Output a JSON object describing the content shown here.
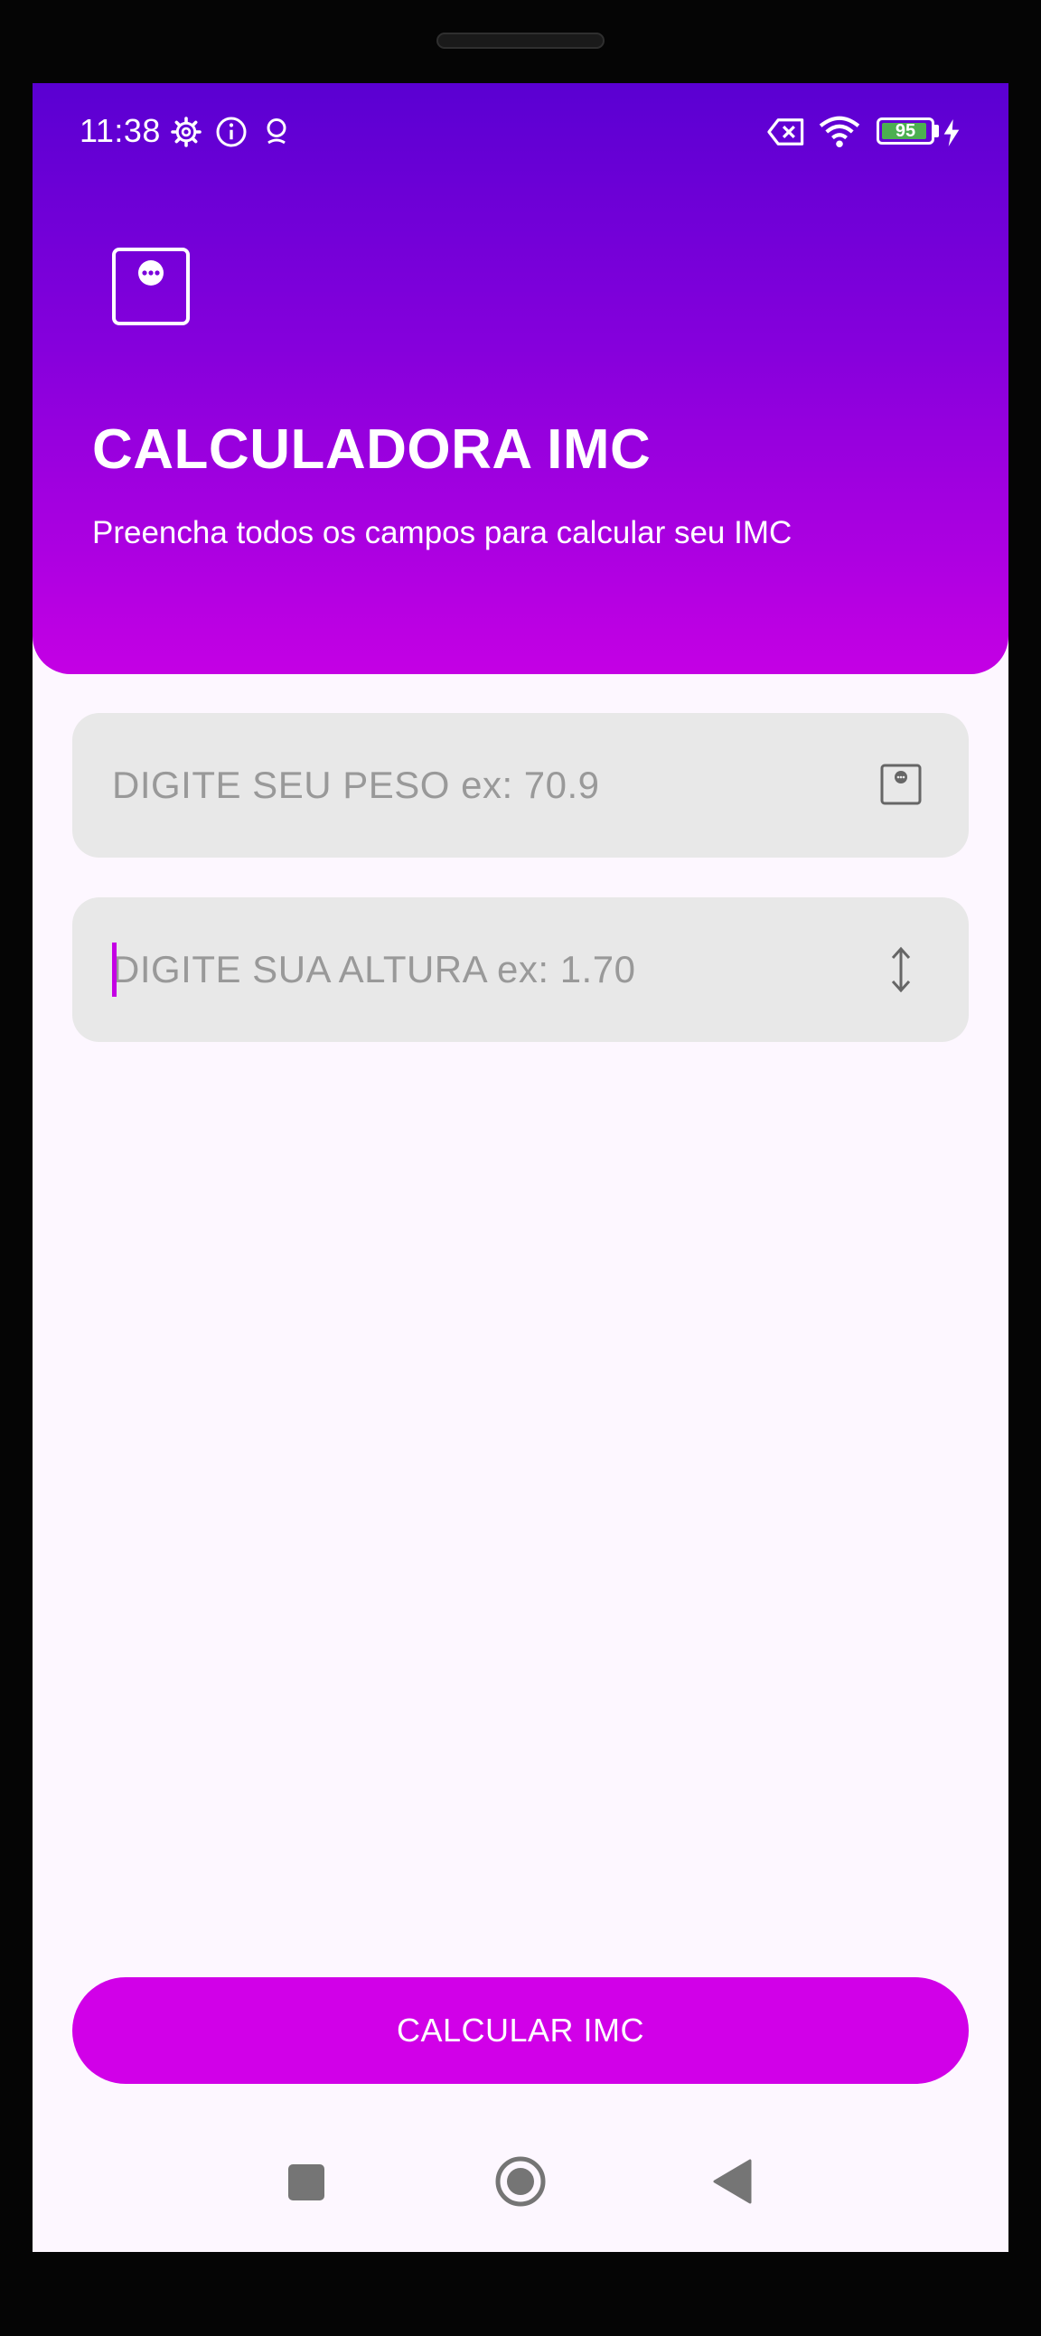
{
  "status_bar": {
    "time": "11:38",
    "battery_level": "95",
    "battery_fraction": 0.95,
    "icons": [
      "settings-icon",
      "info-icon",
      "location-icon",
      "sim-disabled-icon",
      "wifi-icon",
      "battery-icon",
      "charging-icon"
    ]
  },
  "header": {
    "logo_icon": "scale-icon",
    "title": "CALCULADORA IMC",
    "subtitle": "Preencha todos os campos para calcular seu IMC"
  },
  "form": {
    "weight": {
      "placeholder": "DIGITE SEU PESO ex: 70.9",
      "value": "",
      "icon": "scale-icon"
    },
    "height": {
      "placeholder": "DIGITE SUA ALTURA ex: 1.70",
      "value": "",
      "icon": "vertical-arrows-icon",
      "focused": true
    }
  },
  "actions": {
    "calculate_label": "CALCULAR IMC"
  },
  "navigation": {
    "buttons": [
      "recents-square-icon",
      "home-circle-icon",
      "back-triangle-icon"
    ]
  },
  "colors": {
    "header_gradient_top": "#5a00d2",
    "header_gradient_bottom": "#c400e4",
    "button": "#d100e8",
    "field_background": "#e8e8e8",
    "screen_background": "#fdf7ff",
    "battery_fill": "#4caf50"
  }
}
